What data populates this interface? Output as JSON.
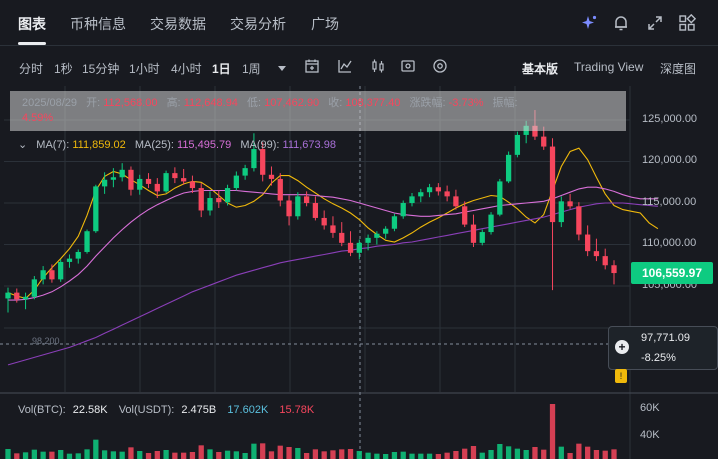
{
  "tabs": [
    {
      "label": "图表",
      "active": true
    },
    {
      "label": "币种信息",
      "active": false
    },
    {
      "label": "交易数据",
      "active": false
    },
    {
      "label": "交易分析",
      "active": false
    },
    {
      "label": "广场",
      "active": false
    }
  ],
  "header_icons": [
    "ai-sparkle-icon",
    "bell-icon",
    "expand-icon",
    "layout-grid-icon"
  ],
  "timeframes": [
    {
      "label": "分时",
      "active": false
    },
    {
      "label": "1秒",
      "active": false
    },
    {
      "label": "15分钟",
      "active": false
    },
    {
      "label": "1小时",
      "active": false
    },
    {
      "label": "4小时",
      "active": false
    },
    {
      "label": "1日",
      "active": true
    },
    {
      "label": "1周",
      "active": false
    }
  ],
  "toolbar_icons": [
    "dropdown-caret-icon",
    "calendar-add-icon",
    "indicator-icon",
    "candlestick-type-icon",
    "settings-icon",
    "display-icon"
  ],
  "views": [
    {
      "label": "基本版",
      "active": true
    },
    {
      "label": "Trading View",
      "active": false
    },
    {
      "label": "深度图",
      "active": false
    }
  ],
  "ohlc": {
    "date": "2025/08/29",
    "open_label": "开:",
    "open": "112,568.00",
    "high_label": "高:",
    "high": "112,648.94",
    "low_label": "低:",
    "low": "107,462.90",
    "close_label": "收:",
    "close": "108,377.40",
    "change_label": "涨跌幅:",
    "change": "-3.73%",
    "amplitude_label": "振幅:",
    "amplitude": "4.59%"
  },
  "ma": {
    "ma7_label": "MA(7):",
    "ma7": "111,859.02",
    "ma25_label": "MA(25):",
    "ma25": "115,495.79",
    "ma99_label": "MA(99):",
    "ma99": "111,673.98"
  },
  "y_axis": [
    "125,000.00",
    "120,000.00",
    "115,000.00",
    "110,000.00",
    "105,000.00"
  ],
  "current_price": "106,559.97",
  "crosshair": {
    "value": "97,771.09",
    "pct": "-8.25%"
  },
  "low_marker_label": "98,200",
  "marker_glyph": "!",
  "volume": {
    "vol_btc_label": "Vol(BTC):",
    "vol_btc": "22.58K",
    "vol_usdt_label": "Vol(USDT):",
    "vol_usdt": "2.475B",
    "ma5": "17.602K",
    "ma10": "15.78K",
    "axis": [
      "60K",
      "40K"
    ]
  },
  "colors": {
    "up": "#0ecb81",
    "down": "#f6465d",
    "ma7": "#f0b90b",
    "ma25": "#d86fd8",
    "ma99": "#8a3fb8",
    "volma": "#5bc0de"
  },
  "chart_data": {
    "type": "candlestick",
    "series": [
      {
        "name": "MA(7)",
        "values": [
          104200,
          103800,
          103500,
          104500,
          106000,
          107200,
          108300,
          109500,
          111000,
          113500,
          116500,
          118200,
          118800,
          118500,
          117800,
          117200,
          116500,
          115900,
          116100,
          116800,
          117300,
          117600,
          117500,
          116800,
          115900,
          115000,
          114500,
          114700,
          115200,
          116000,
          117400,
          118300,
          118300,
          117700,
          116900,
          116200,
          115500,
          114900,
          114400,
          113800,
          113000,
          112000,
          111200,
          110500,
          110300,
          110800,
          111400,
          112100,
          112700,
          113200,
          113800,
          114400,
          114900,
          115300,
          115600,
          115900,
          115800,
          115100,
          114300,
          113300,
          112600,
          113600,
          116500,
          119400,
          121200,
          121600,
          120200,
          118100,
          116100,
          114700,
          114200,
          114000,
          113800,
          112600,
          111900
        ]
      },
      {
        "name": "MA(25)",
        "values": [
          103300,
          103300,
          103400,
          103600,
          103900,
          104300,
          104900,
          105600,
          106400,
          107400,
          108600,
          109700,
          110800,
          111800,
          112700,
          113500,
          114200,
          114800,
          115300,
          115800,
          116200,
          116400,
          116500,
          116500,
          116500,
          116500,
          116500,
          116400,
          116300,
          116200,
          116100,
          116000,
          116000,
          116000,
          116000,
          115900,
          115800,
          115700,
          115500,
          115300,
          115000,
          114700,
          114400,
          114100,
          113800,
          113600,
          113500,
          113400,
          113400,
          113500,
          113600,
          113700,
          113900,
          114100,
          114300,
          114500,
          114700,
          114800,
          114900,
          115000,
          115100,
          115200,
          115500,
          115900,
          116300,
          116700,
          116900,
          116900,
          116700,
          116400,
          116000,
          115700,
          115500,
          115500,
          115500
        ]
      },
      {
        "name": "MA(99)",
        "values": [
          95500,
          95800,
          96100,
          96400,
          96700,
          97000,
          97300,
          97600,
          98000,
          98400,
          98800,
          99300,
          99800,
          100300,
          100800,
          101300,
          101800,
          102300,
          102800,
          103300,
          103800,
          104300,
          104700,
          105100,
          105500,
          105900,
          106300,
          106600,
          106900,
          107200,
          107500,
          107800,
          108000,
          108200,
          108400,
          108600,
          108800,
          109000,
          109200,
          109300,
          109500,
          109600,
          109800,
          109900,
          110000,
          110200,
          110300,
          110500,
          110700,
          110900,
          111100,
          111300,
          111500,
          111700,
          111900,
          112100,
          112300,
          112500,
          112700,
          112900,
          113100,
          113300,
          113600,
          113900,
          114200,
          114500,
          114700,
          114900,
          115000,
          115000,
          115000,
          114900,
          114800,
          114700,
          114600
        ]
      }
    ],
    "candles": [
      [
        103500,
        104800,
        101800,
        104200
      ],
      [
        104200,
        104700,
        103000,
        103400
      ],
      [
        103400,
        104200,
        102200,
        103700
      ],
      [
        103700,
        106200,
        103400,
        105800
      ],
      [
        105800,
        107400,
        105200,
        106900
      ],
      [
        106900,
        107600,
        105400,
        105800
      ],
      [
        105800,
        108200,
        105500,
        107900
      ],
      [
        107900,
        108800,
        107200,
        108300
      ],
      [
        108300,
        109400,
        107700,
        109100
      ],
      [
        109100,
        111800,
        108900,
        111600
      ],
      [
        111600,
        117200,
        111400,
        117000
      ],
      [
        117000,
        118700,
        116100,
        117800
      ],
      [
        117800,
        119200,
        116900,
        118100
      ],
      [
        118100,
        119800,
        117600,
        119000
      ],
      [
        119000,
        119400,
        115900,
        116600
      ],
      [
        116600,
        118400,
        116000,
        117900
      ],
      [
        117900,
        118600,
        116800,
        117300
      ],
      [
        117300,
        118000,
        115600,
        116400
      ],
      [
        116400,
        118900,
        116200,
        118600
      ],
      [
        118600,
        119300,
        117400,
        118000
      ],
      [
        118000,
        119100,
        117200,
        117600
      ],
      [
        117600,
        118300,
        116200,
        116800
      ],
      [
        116800,
        117400,
        113300,
        114100
      ],
      [
        114100,
        116400,
        113500,
        115600
      ],
      [
        115600,
        116500,
        114400,
        115100
      ],
      [
        115100,
        117200,
        114700,
        116800
      ],
      [
        116800,
        118800,
        116500,
        118300
      ],
      [
        118300,
        119600,
        117800,
        119200
      ],
      [
        119200,
        123400,
        118800,
        121500
      ],
      [
        121500,
        122300,
        117600,
        118400
      ],
      [
        118400,
        119400,
        117100,
        117900
      ],
      [
        117900,
        118600,
        114600,
        115300
      ],
      [
        115300,
        115900,
        112300,
        113400
      ],
      [
        113400,
        116300,
        113000,
        115800
      ],
      [
        115800,
        116400,
        114600,
        115000
      ],
      [
        115000,
        115800,
        112900,
        113200
      ],
      [
        113200,
        114100,
        111800,
        112300
      ],
      [
        112300,
        113400,
        110800,
        111400
      ],
      [
        111400,
        112700,
        109800,
        110200
      ],
      [
        110200,
        111600,
        108600,
        109000
      ],
      [
        109000,
        110600,
        108200,
        110200
      ],
      [
        110200,
        111200,
        109300,
        110800
      ],
      [
        110800,
        111600,
        110000,
        111300
      ],
      [
        111300,
        112200,
        110700,
        111900
      ],
      [
        111900,
        113700,
        111600,
        113400
      ],
      [
        113400,
        115300,
        113100,
        115000
      ],
      [
        115000,
        116200,
        114600,
        115800
      ],
      [
        115800,
        116700,
        115100,
        116300
      ],
      [
        116300,
        117300,
        115700,
        116900
      ],
      [
        116900,
        117400,
        115900,
        116400
      ],
      [
        116400,
        117100,
        115200,
        115800
      ],
      [
        115800,
        116600,
        114200,
        114600
      ],
      [
        114600,
        115200,
        112100,
        112400
      ],
      [
        112400,
        113600,
        109700,
        110200
      ],
      [
        110200,
        111800,
        109900,
        111500
      ],
      [
        111500,
        113900,
        111200,
        113600
      ],
      [
        113600,
        117900,
        113400,
        117600
      ],
      [
        117600,
        121200,
        117400,
        120800
      ],
      [
        120800,
        123600,
        120500,
        123200
      ],
      [
        123200,
        124900,
        122200,
        124300
      ],
      [
        124300,
        126200,
        122600,
        123000
      ],
      [
        123000,
        124200,
        121400,
        121800
      ],
      [
        121800,
        122800,
        104500,
        112700
      ],
      [
        112700,
        115800,
        112100,
        115200
      ],
      [
        115200,
        116100,
        114300,
        114600
      ],
      [
        114600,
        115100,
        110500,
        111200
      ],
      [
        111200,
        112300,
        108600,
        109200
      ],
      [
        109200,
        110700,
        108000,
        108600
      ],
      [
        108600,
        109500,
        107000,
        107500
      ],
      [
        107500,
        108100,
        105200,
        106559.97
      ]
    ]
  }
}
